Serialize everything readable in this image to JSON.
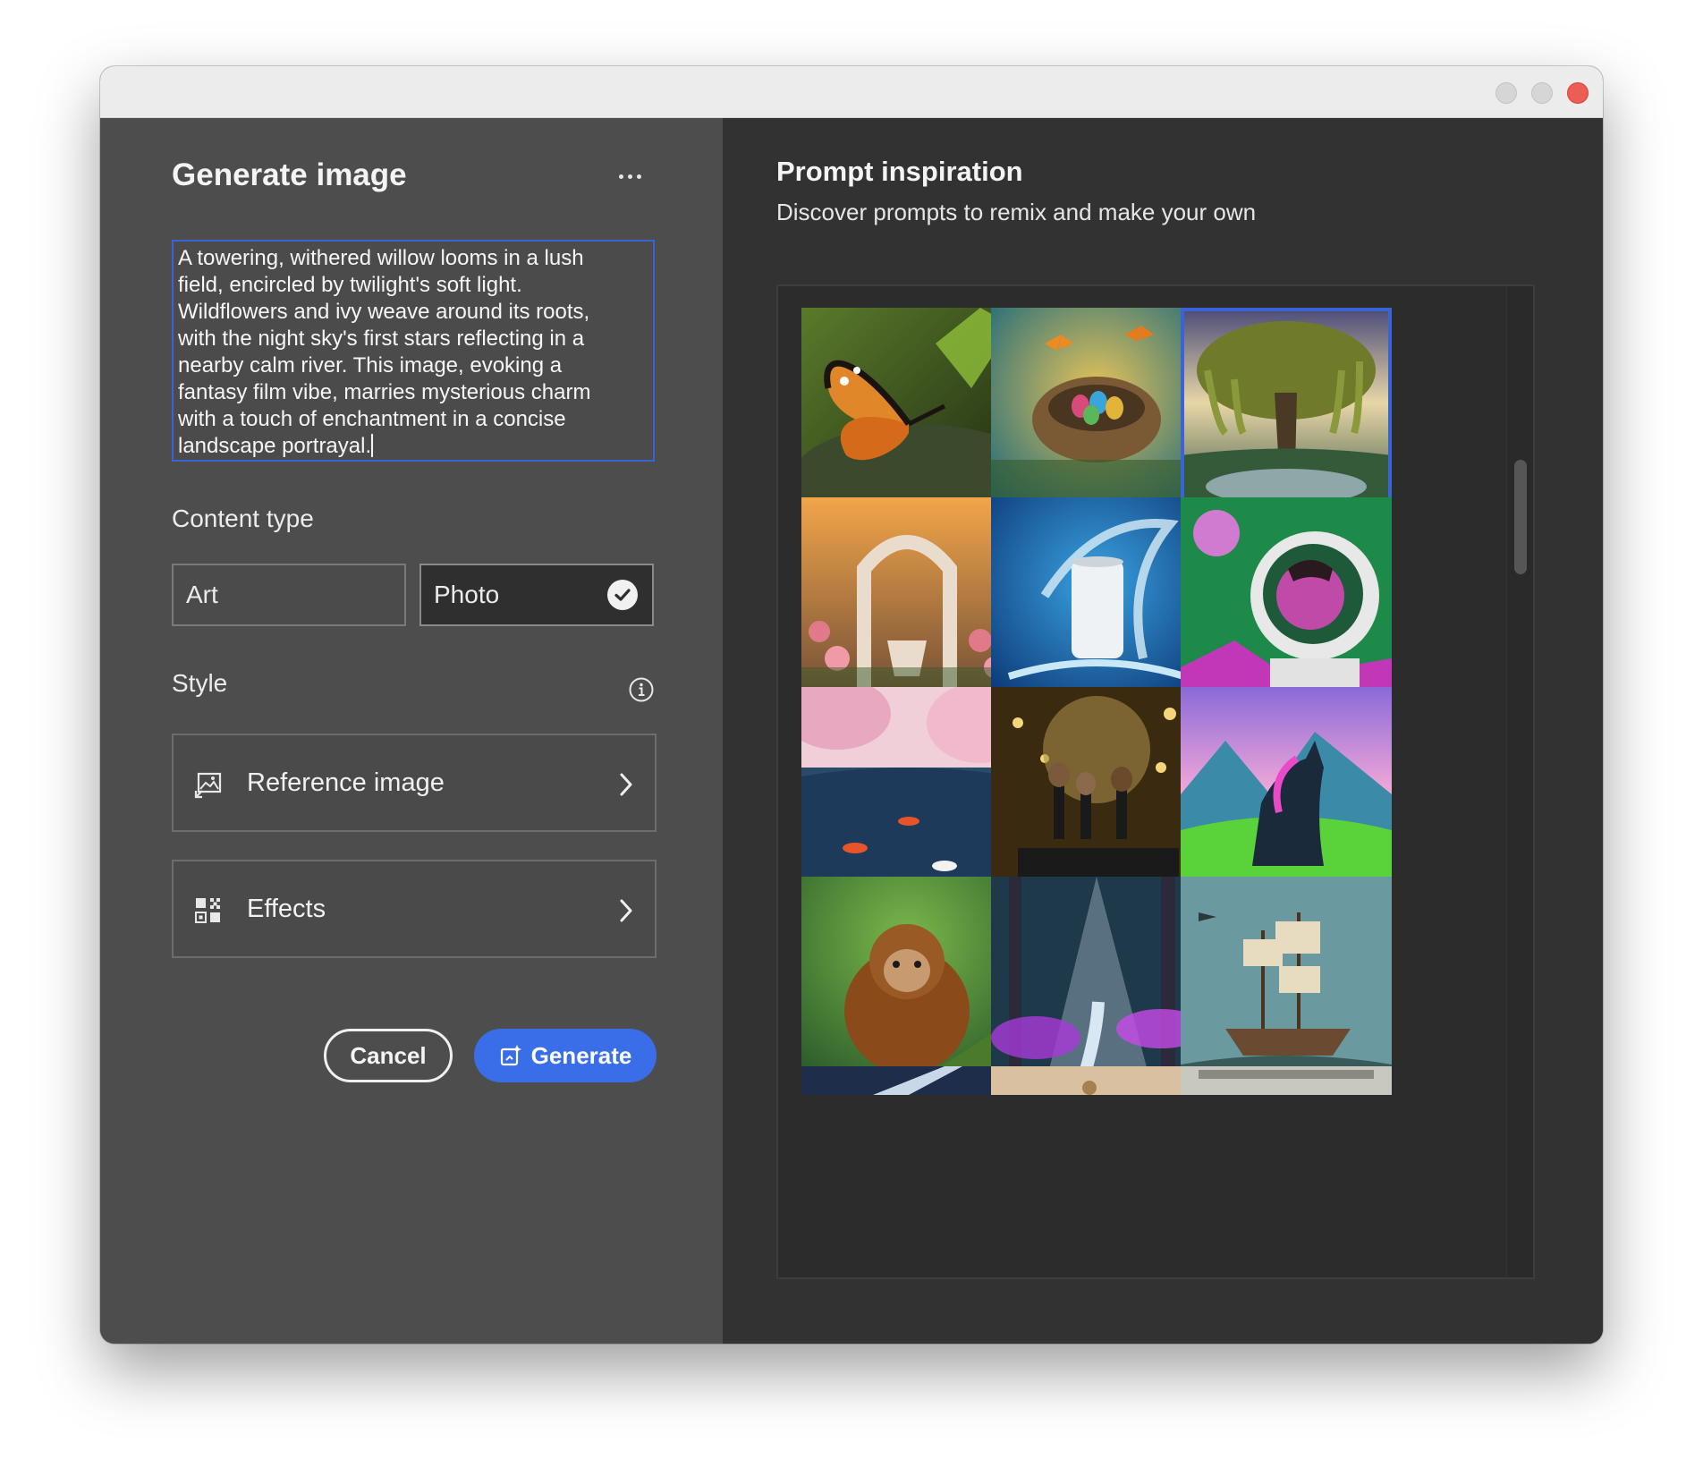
{
  "dialog": {
    "title": "Generate image",
    "prompt_text": "A towering, withered willow looms in a lush\nfield, encircled by twilight's soft light.\nWildflowers and ivy weave around its roots,\nwith the night sky's first stars reflecting in a\nnearby calm river. This image, evoking a\nfantasy film vibe, marries mysterious charm\nwith a touch of enchantment in a concise\nlandscape portrayal.",
    "content_type_label": "Content type",
    "content_types": [
      {
        "label": "Art",
        "selected": false
      },
      {
        "label": "Photo",
        "selected": true
      }
    ],
    "style_label": "Style",
    "style_rows": [
      {
        "label": "Reference image",
        "icon": "reference-image-icon"
      },
      {
        "label": "Effects",
        "icon": "effects-icon"
      }
    ],
    "cancel_label": "Cancel",
    "generate_label": "Generate"
  },
  "inspiration": {
    "title": "Prompt inspiration",
    "subtitle": "Discover prompts to remix and make your own",
    "images": [
      {
        "subject": "butterfly on leaf",
        "selected": false
      },
      {
        "subject": "bird nest with colorful eggs and butterflies",
        "selected": false
      },
      {
        "subject": "willow tree by river at twilight",
        "selected": true
      },
      {
        "subject": "marble arch with roses at sunset",
        "selected": false
      },
      {
        "subject": "white can with water splash",
        "selected": false
      },
      {
        "subject": "astronaut in pop-art style",
        "selected": false
      },
      {
        "subject": "cherry blossoms over koi pond",
        "selected": false
      },
      {
        "subject": "makeup brushes on vanity with lights",
        "selected": false
      },
      {
        "subject": "unicorn in mountain meadow",
        "selected": false
      },
      {
        "subject": "baby orangutan on mossy branch",
        "selected": false
      },
      {
        "subject": "sunlit forest stream with purple flowers",
        "selected": false
      },
      {
        "subject": "sunken sailing ship illustration",
        "selected": false
      }
    ]
  },
  "colors": {
    "accent": "#3a6ee8",
    "selection_border": "#3a63d6",
    "close_button": "#ec5e53"
  }
}
